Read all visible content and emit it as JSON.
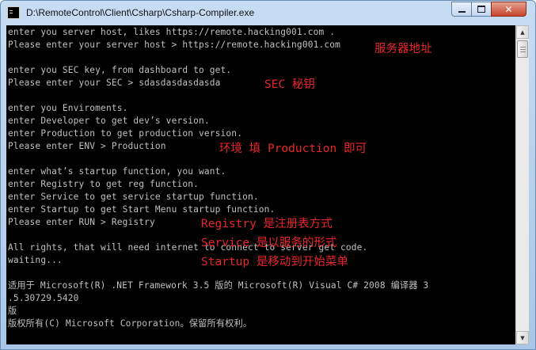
{
  "window": {
    "title": "D:\\RemoteControl\\Client\\Csharp\\Csharp-Compiler.exe",
    "minimize_icon": "minimize-icon",
    "maximize_icon": "maximize-icon",
    "close_icon": "close-icon"
  },
  "console": {
    "lines": [
      "enter you server host, likes https://remote.hacking001.com .",
      "Please enter your server host > https://remote.hacking001.com",
      "",
      "enter you SEC key, from dashboard to get.",
      "Please enter your SEC > sdasdasdasdasda",
      "",
      "enter you Enviroments.",
      "enter Developer to get dev’s version.",
      "enter Production to get production version.",
      "Please enter ENV > Production",
      "",
      "enter what’s startup function, you want.",
      "enter Registry to get reg function.",
      "enter Service to get service startup function.",
      "enter Startup to get Start Menu startup function.",
      "Please enter RUN > Registry",
      "",
      "All rights, that will need internet to connect to server get code.",
      "waiting...",
      "",
      "适用于 Microsoft(R) .NET Framework 3.5 版的 Microsoft(R) Visual C# 2008 编译器 3",
      ".5.30729.5420",
      "版",
      "版权所有(C) Microsoft Corporation。保留所有权利。"
    ]
  },
  "annotations": {
    "server_host": "服务器地址",
    "sec_key": "SEC 秘钥",
    "env": "环境 填 Production 即可",
    "registry": "Registry 是注册表方式",
    "service": "Service 是以服务的形式",
    "startup": "Startup 是移动到开始菜单"
  },
  "colors": {
    "console_bg": "#000000",
    "console_text": "#c0c0c0",
    "annotation": "#e8262a"
  }
}
